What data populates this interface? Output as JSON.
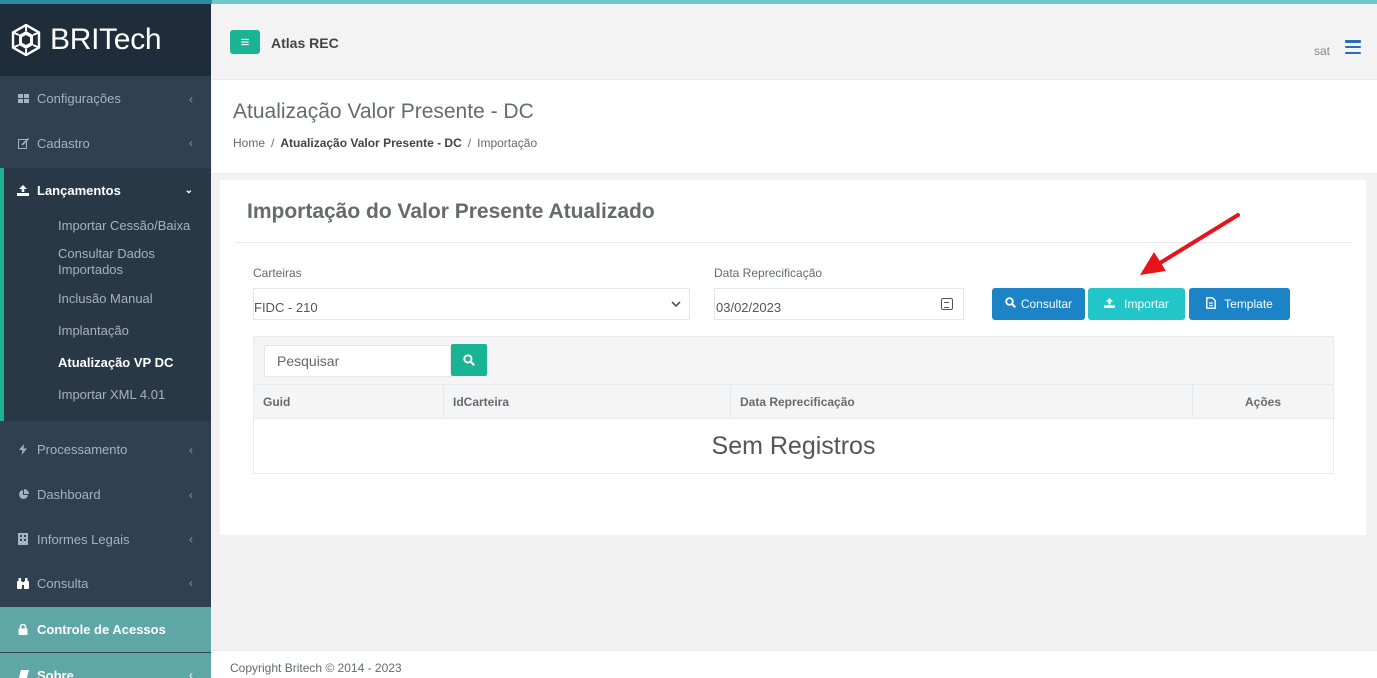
{
  "brand": {
    "name": "BRITech"
  },
  "header": {
    "app_name": "Atlas REC",
    "user": "sat",
    "menu_icon": "hamburger-icon"
  },
  "sidebar": {
    "items": [
      {
        "label": "Configurações",
        "icon": "grid-icon"
      },
      {
        "label": "Cadastro",
        "icon": "edit-icon"
      },
      {
        "label": "Lançamentos",
        "icon": "upload-icon"
      },
      {
        "label": "Processamento",
        "icon": "bolt-icon"
      },
      {
        "label": "Dashboard",
        "icon": "pie-chart-icon"
      },
      {
        "label": "Informes Legais",
        "icon": "building-icon"
      },
      {
        "label": "Consulta",
        "icon": "binoculars-icon"
      },
      {
        "label": "Controle de Acessos",
        "icon": "lock-icon"
      },
      {
        "label": "Sobre",
        "icon": "book-icon"
      }
    ],
    "submenu": [
      "Importar Cessão/Baixa",
      "Consultar Dados Importados",
      "Inclusão Manual",
      "Implantação",
      "Atualização VP DC",
      "Importar XML 4.01"
    ]
  },
  "page": {
    "title": "Atualização Valor Presente - DC",
    "breadcrumb": {
      "home": "Home",
      "section": "Atualização Valor Presente - DC",
      "current": "Importação",
      "separator": "/"
    }
  },
  "panel": {
    "title": "Importação do Valor Presente Atualizado",
    "carteiras_label": "Carteiras",
    "carteiras_value": "FIDC - 210",
    "data_label": "Data Reprecificação",
    "data_value": "03/02/2023",
    "buttons": {
      "consultar": "Consultar",
      "importar": "Importar",
      "template": "Template"
    }
  },
  "table": {
    "search_placeholder": "Pesquisar",
    "columns": [
      "Guid",
      "IdCarteira",
      "Data Reprecificação",
      "Ações"
    ],
    "empty_text": "Sem Registros"
  },
  "footer": {
    "copyright": "Copyright Britech © 2014 - 2023"
  },
  "colors": {
    "accent": "#1ab394",
    "primary": "#1c84c6",
    "info": "#23c6c8",
    "sidebar": "#2f4050",
    "annotation_arrow": "#e8141c"
  }
}
